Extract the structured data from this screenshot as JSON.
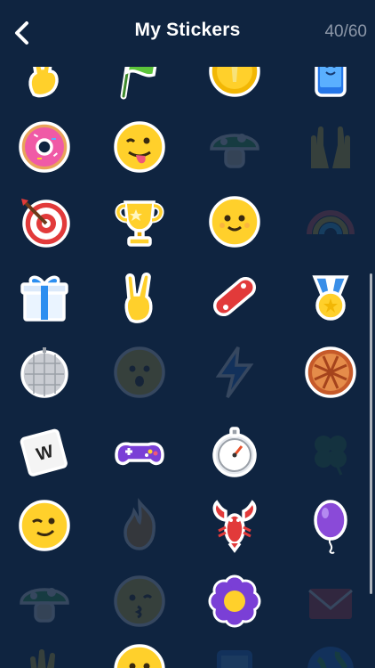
{
  "header": {
    "title": "My Stickers",
    "counter": "40/60"
  },
  "colors": {
    "background": "#0f2440",
    "accent_yellow": "#ffd02b",
    "locked_tint": "#8fa0b6"
  },
  "stickers": [
    {
      "icon": "peace-hand-icon",
      "unlocked": true
    },
    {
      "icon": "green-flag-icon",
      "unlocked": true
    },
    {
      "icon": "gold-coin-icon",
      "unlocked": true
    },
    {
      "icon": "smartphone-icon",
      "unlocked": true
    },
    {
      "icon": "donut-icon",
      "unlocked": true
    },
    {
      "icon": "tongue-wink-face-icon",
      "unlocked": true
    },
    {
      "icon": "mushroom-icon",
      "unlocked": false
    },
    {
      "icon": "raised-hands-icon",
      "unlocked": false
    },
    {
      "icon": "target-dart-icon",
      "unlocked": true
    },
    {
      "icon": "trophy-icon",
      "unlocked": true
    },
    {
      "icon": "smiley-face-icon",
      "unlocked": true
    },
    {
      "icon": "rainbow-icon",
      "unlocked": false
    },
    {
      "icon": "gift-box-icon",
      "unlocked": true
    },
    {
      "icon": "rock-hand-icon",
      "unlocked": true
    },
    {
      "icon": "skateboard-icon",
      "unlocked": true
    },
    {
      "icon": "medal-icon",
      "unlocked": true
    },
    {
      "icon": "disco-ball-icon",
      "unlocked": true
    },
    {
      "icon": "surprised-face-icon",
      "unlocked": false
    },
    {
      "icon": "lightning-icon",
      "unlocked": false
    },
    {
      "icon": "pie-icon",
      "unlocked": true
    },
    {
      "icon": "letter-tile-icon",
      "tile_letter": "W",
      "unlocked": true
    },
    {
      "icon": "game-controller-icon",
      "unlocked": true
    },
    {
      "icon": "stopwatch-icon",
      "unlocked": true
    },
    {
      "icon": "four-leaf-clover-icon",
      "unlocked": false
    },
    {
      "icon": "winking-face-icon",
      "unlocked": true
    },
    {
      "icon": "fire-face-icon",
      "unlocked": false
    },
    {
      "icon": "lobster-icon",
      "unlocked": true
    },
    {
      "icon": "purple-balloon-icon",
      "unlocked": true
    },
    {
      "icon": "mushroom-icon",
      "unlocked": false
    },
    {
      "icon": "kissing-face-icon",
      "unlocked": false
    },
    {
      "icon": "purple-flower-icon",
      "unlocked": true
    },
    {
      "icon": "envelope-icon",
      "unlocked": false
    },
    {
      "icon": "hand-icon",
      "unlocked": false
    },
    {
      "icon": "smiley-face-icon",
      "unlocked": true
    },
    {
      "icon": "tablet-icon",
      "unlocked": false
    },
    {
      "icon": "globe-icon",
      "unlocked": false
    }
  ]
}
